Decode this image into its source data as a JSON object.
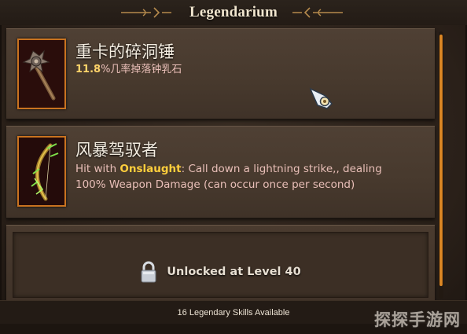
{
  "header": {
    "title": "Legendarium"
  },
  "skills": [
    {
      "name": "重卡的碎洞锤",
      "description": {
        "pct": "11.8",
        "rest": "%几率掉落钟乳石"
      },
      "icon": "mace-icon"
    },
    {
      "name": "风暴驾驭者",
      "description": {
        "prefix": "Hit with ",
        "keyword": "Onslaught",
        "line1_rest": ": Call down a lightning strike,, dealing",
        "line2": "100% Weapon Damage (can occur once per second)"
      },
      "icon": "bow-icon"
    }
  ],
  "locked": {
    "text": "Unlocked at Level 40",
    "icon": "padlock-icon"
  },
  "footer": {
    "text": "16 Legendary Skills Available"
  },
  "watermark": "探探手游网",
  "colors": {
    "accent": "#e8922a",
    "keyword": "#ffce3c",
    "frame": "#c97320"
  }
}
